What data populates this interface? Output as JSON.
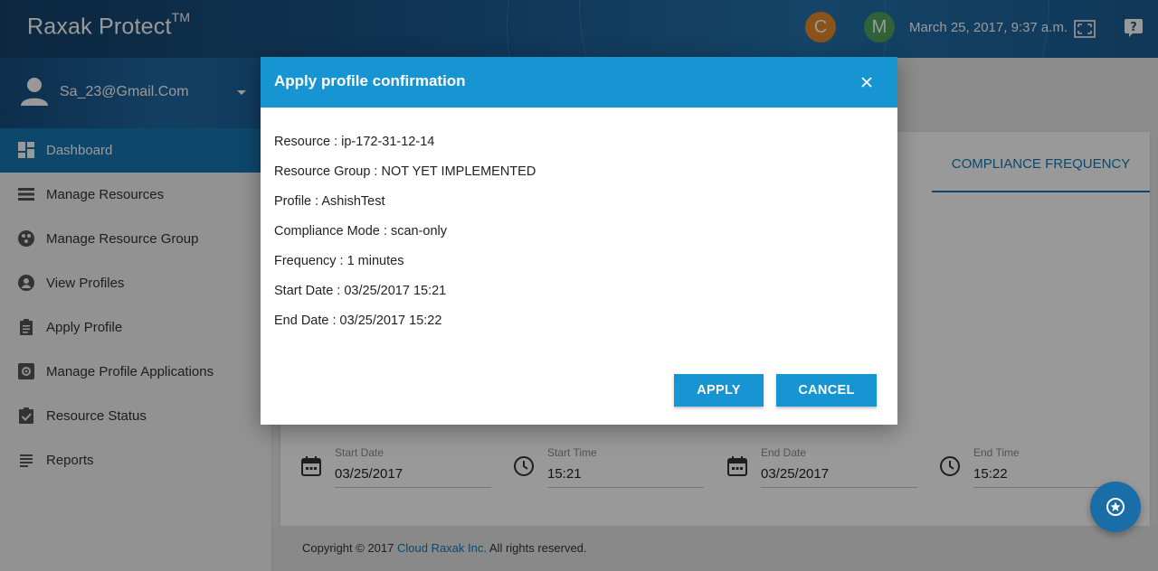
{
  "header": {
    "brand": "Raxak Protect",
    "brand_mark": "TM",
    "avatars": [
      {
        "letter": "C",
        "color": "#e8892a"
      },
      {
        "letter": "M",
        "color": "#4fa35a"
      }
    ],
    "datetime": "March 25, 2017, 9:37 a.m.",
    "icons": [
      "fullscreen-icon",
      "help-icon"
    ]
  },
  "sidebar": {
    "user": "Sa_23@Gmail.Com",
    "items": [
      {
        "label": "Dashboard",
        "icon": "dashboard-icon",
        "active": true
      },
      {
        "label": "Manage Resources",
        "icon": "list-icon"
      },
      {
        "label": "Manage Resource Group",
        "icon": "group-icon"
      },
      {
        "label": "View Profiles",
        "icon": "profile-icon"
      },
      {
        "label": "Apply Profile",
        "icon": "clipboard-icon"
      },
      {
        "label": "Manage Profile Applications",
        "icon": "settings-icon"
      },
      {
        "label": "Resource Status",
        "icon": "checklist-icon"
      },
      {
        "label": "Reports",
        "icon": "reports-icon"
      }
    ]
  },
  "main": {
    "tab": "COMPLIANCE FREQUENCY",
    "fields": [
      {
        "label": "Start Date",
        "value": "03/25/2017",
        "icon": "calendar-icon"
      },
      {
        "label": "Start Time",
        "value": "15:21",
        "icon": "clock-icon"
      },
      {
        "label": "End Date",
        "value": "03/25/2017",
        "icon": "calendar-icon"
      },
      {
        "label": "End Time",
        "value": "15:22",
        "icon": "clock-icon"
      }
    ],
    "footer": {
      "prefix": "Copyright © 2017 ",
      "link": "Cloud Raxak Inc.",
      "suffix": " All rights reserved."
    }
  },
  "modal": {
    "title": "Apply profile confirmation",
    "rows": [
      "Resource : ip-172-31-12-14",
      "Resource Group : NOT YET IMPLEMENTED",
      "Profile : AshishTest",
      "Compliance Mode : scan-only",
      "Frequency : 1 minutes",
      "Start Date : 03/25/2017 15:21",
      "End Date : 03/25/2017 15:22"
    ],
    "apply_label": "APPLY",
    "cancel_label": "CANCEL"
  },
  "colors": {
    "primary": "#1795d3",
    "nav_active": "#1777b5",
    "header": "#1b5a8f"
  }
}
